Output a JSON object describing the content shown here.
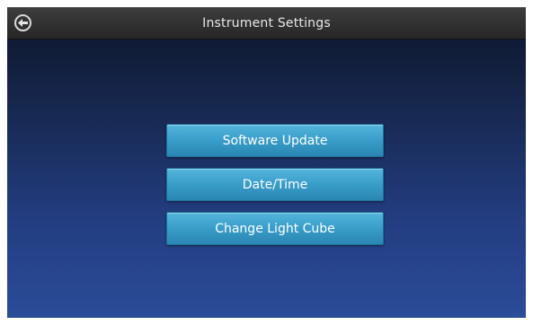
{
  "header": {
    "title": "Instrument Settings",
    "back_icon": "back-arrow-circle-icon"
  },
  "menu": {
    "items": [
      {
        "label": "Software Update"
      },
      {
        "label": "Date/Time"
      },
      {
        "label": "Change Light Cube"
      }
    ]
  },
  "colors": {
    "button": "#3a9fca",
    "background_top": "#0c1528",
    "background_bottom": "#2b4c98",
    "titlebar": "#303030"
  }
}
